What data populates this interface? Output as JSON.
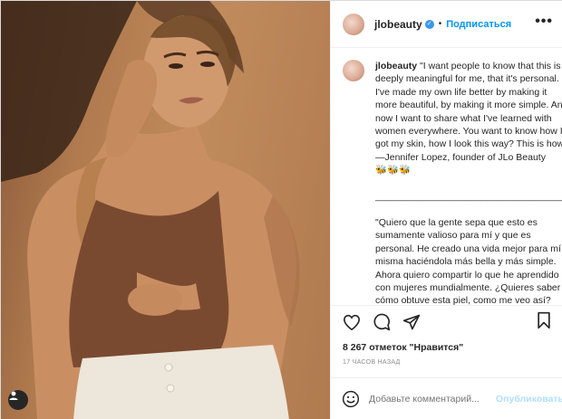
{
  "post": {
    "username": "jlobeauty",
    "follow_label": "Подписаться",
    "separator": "•",
    "more_icon": "•••",
    "caption_username": "jlobeauty",
    "caption_text": " \"I want people to know that this is deeply meaningful for me, that it's personal. I've made my own life better by making it more beautiful, by making it more simple. And now I want to share what I've learned with women everywhere. You want to know how I got my skin, how I look this way? This is how.\" —Jennifer Lopez, founder of JLo Beauty\n🐝🐝🐝\n\n____________________________________\n\n\"Quiero que la gente sepa que esto es sumamente valioso para mí y que es personal. He creado una vida mejor para mí misma haciéndola más bella y más simple. Ahora quiero compartir lo que he aprendido con mujeres mundialmente. ¿Quieres saber cómo obtuve esta piel, como me veo así? Este es como.",
    "likes_text": "8 267 отметок \"Нравится\"",
    "time_text": "17 ЧАСОВ НАЗАД",
    "comment_placeholder": "Добавьте комментарий...",
    "publish_label": "Опубликовать"
  },
  "icons": {
    "like": "heart-icon",
    "comment": "comment-icon",
    "share": "share-icon",
    "save": "bookmark-icon",
    "emoji": "emoji-icon",
    "tagged": "user-tag-icon",
    "verified": "verified-badge-icon"
  },
  "colors": {
    "accent": "#0095f6",
    "publish_disabled": "#b2dffc",
    "verified": "#3897f0"
  }
}
